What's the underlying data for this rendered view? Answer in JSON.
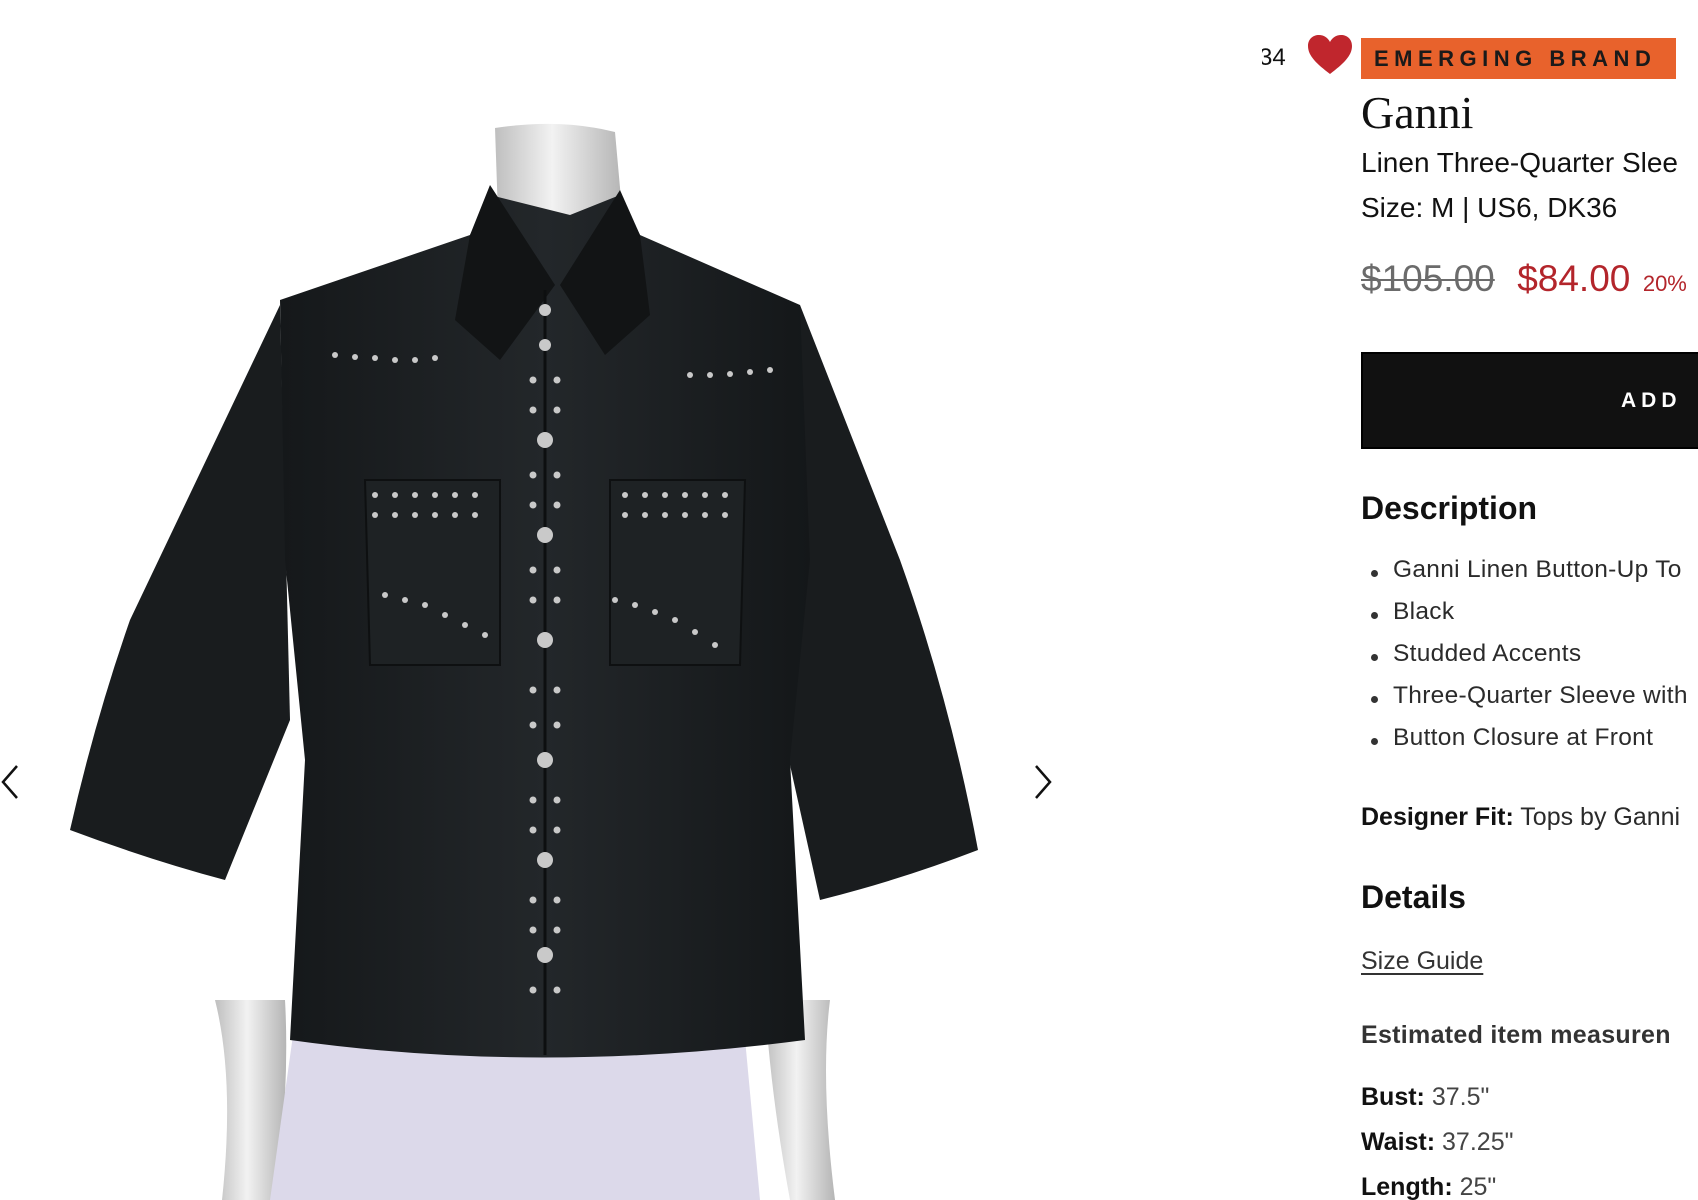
{
  "gallery": {
    "prev_icon": "chevron-left-icon",
    "next_icon": "chevron-right-icon"
  },
  "product": {
    "favorites_count": "34",
    "heart_icon": "heart-icon",
    "badge": "EMERGING BRAND",
    "designer": "Ganni",
    "title": "Linen Three-Quarter Slee",
    "size": "Size: M | US6, DK36",
    "price_original": "$105.00",
    "price_sale": "$84.00",
    "discount": "20%",
    "add_label": "ADD"
  },
  "description": {
    "heading": "Description",
    "items": [
      "Ganni Linen Button-Up To",
      "Black",
      "Studded Accents",
      "Three-Quarter Sleeve with",
      "Button Closure at Front"
    ],
    "fit_label": "Designer Fit:",
    "fit_value": "Tops by Ganni"
  },
  "details": {
    "heading": "Details",
    "size_guide": "Size Guide",
    "measurements_heading": "Estimated item measuren",
    "measurements": [
      {
        "label": "Bust:",
        "value": "37.5\""
      },
      {
        "label": "Waist:",
        "value": "37.25\""
      },
      {
        "label": "Length:",
        "value": "25\""
      }
    ]
  },
  "colors": {
    "badge": "#e8622c",
    "heart": "#c0262d",
    "sale_price": "#b3252b",
    "button": "#111111",
    "shirt": "#1c1f21",
    "skirt": "#d9d6e8"
  }
}
